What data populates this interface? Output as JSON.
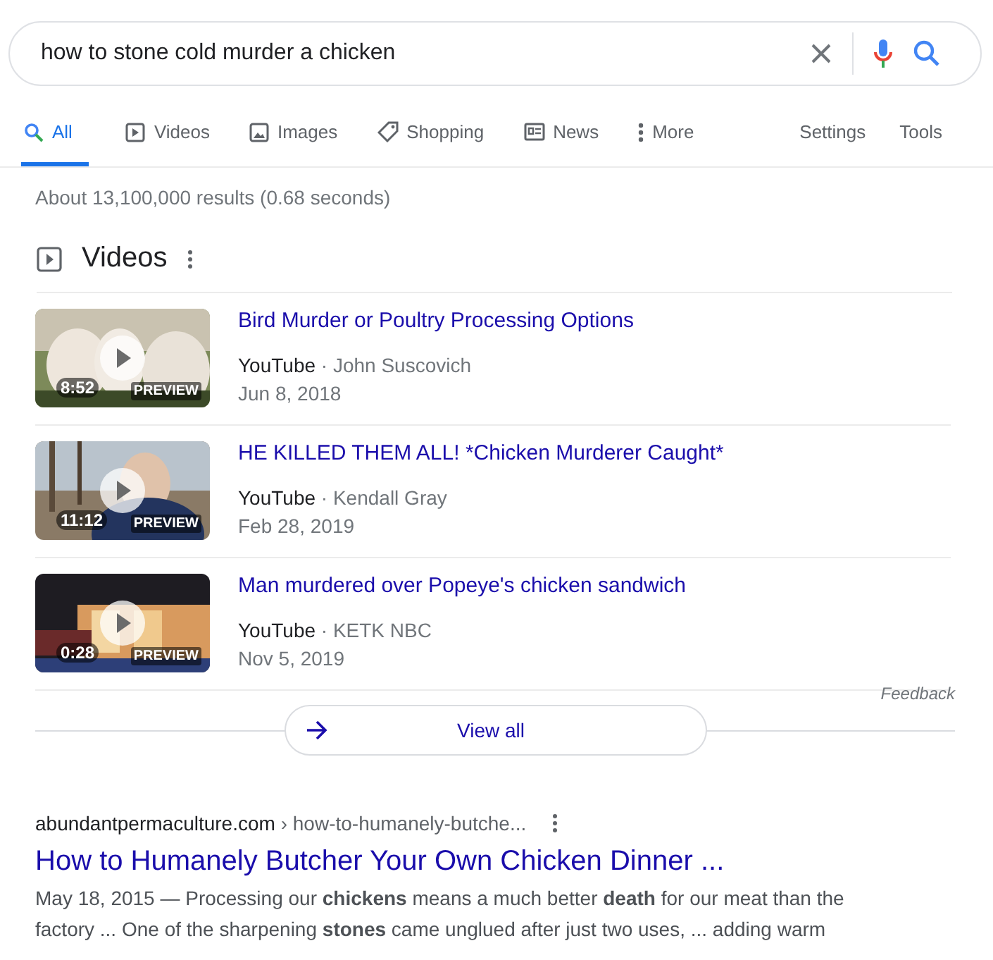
{
  "search": {
    "value": "how to stone cold murder a chicken"
  },
  "tabs": [
    {
      "label": "All",
      "selected": true
    },
    {
      "label": "Videos",
      "selected": false
    },
    {
      "label": "Images",
      "selected": false
    },
    {
      "label": "Shopping",
      "selected": false
    },
    {
      "label": "News",
      "selected": false
    },
    {
      "label": "More",
      "selected": false
    }
  ],
  "tools": [
    "Settings",
    "Tools"
  ],
  "result_stats": "About 13,100,000 results (0.68 seconds)",
  "videos": {
    "heading": "Videos",
    "items": [
      {
        "title": "Bird Murder or Poultry Processing Options",
        "source": "YouTube",
        "separator": "·",
        "channel": "John Suscovich",
        "date": "Jun 8, 2018",
        "duration": "8:52",
        "preview": "PREVIEW"
      },
      {
        "title": "HE KILLED THEM ALL! *Chicken Murderer Caught*",
        "source": "YouTube",
        "separator": "·",
        "channel": "Kendall Gray",
        "date": "Feb 28, 2019",
        "duration": "11:12",
        "preview": "PREVIEW"
      },
      {
        "title": "Man murdered over Popeye's chicken sandwich",
        "source": "YouTube",
        "separator": "·",
        "channel": "KETK NBC",
        "date": "Nov 5, 2019",
        "duration": "0:28",
        "preview": "PREVIEW"
      }
    ],
    "feedback": "Feedback",
    "view_all": "View all"
  },
  "result": {
    "domain": "abundantpermaculture.com",
    "path": "› how-to-humanely-butche...",
    "title": "How to Humanely Butcher Your Own Chicken Dinner ...",
    "snippet": "May 18, 2015 — Processing our **chickens** means a much better **death** for our meat than the factory ... One of the sharpening **stones** came unglued after just two uses, ... adding warm"
  }
}
